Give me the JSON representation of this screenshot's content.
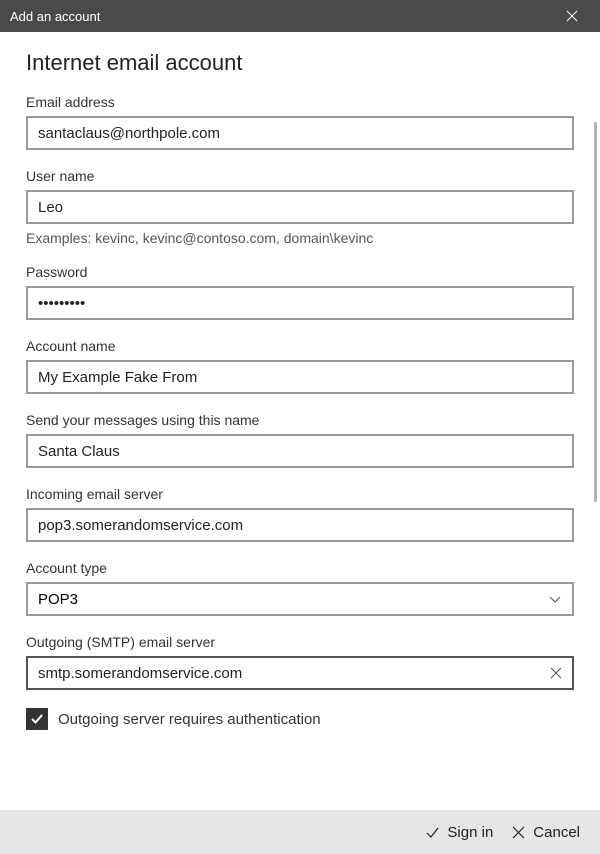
{
  "titlebar": {
    "title": "Add an account"
  },
  "heading": "Internet email account",
  "fields": {
    "email": {
      "label": "Email address",
      "value": "santaclaus@northpole.com"
    },
    "username": {
      "label": "User name",
      "value": "Leo",
      "hint": "Examples: kevinc, kevinc@contoso.com, domain\\kevinc"
    },
    "password": {
      "label": "Password",
      "value": "•••••••••"
    },
    "account_name": {
      "label": "Account name",
      "value": "My Example Fake From"
    },
    "send_name": {
      "label": "Send your messages using this name",
      "value": "Santa Claus"
    },
    "incoming": {
      "label": "Incoming email server",
      "value": "pop3.somerandomservice.com"
    },
    "account_type": {
      "label": "Account type",
      "value": "POP3"
    },
    "outgoing": {
      "label": "Outgoing (SMTP) email server",
      "value": "smtp.somerandomservice.com"
    },
    "auth_checkbox": {
      "label": "Outgoing server requires authentication",
      "checked": true
    }
  },
  "footer": {
    "signin": "Sign in",
    "cancel": "Cancel"
  }
}
